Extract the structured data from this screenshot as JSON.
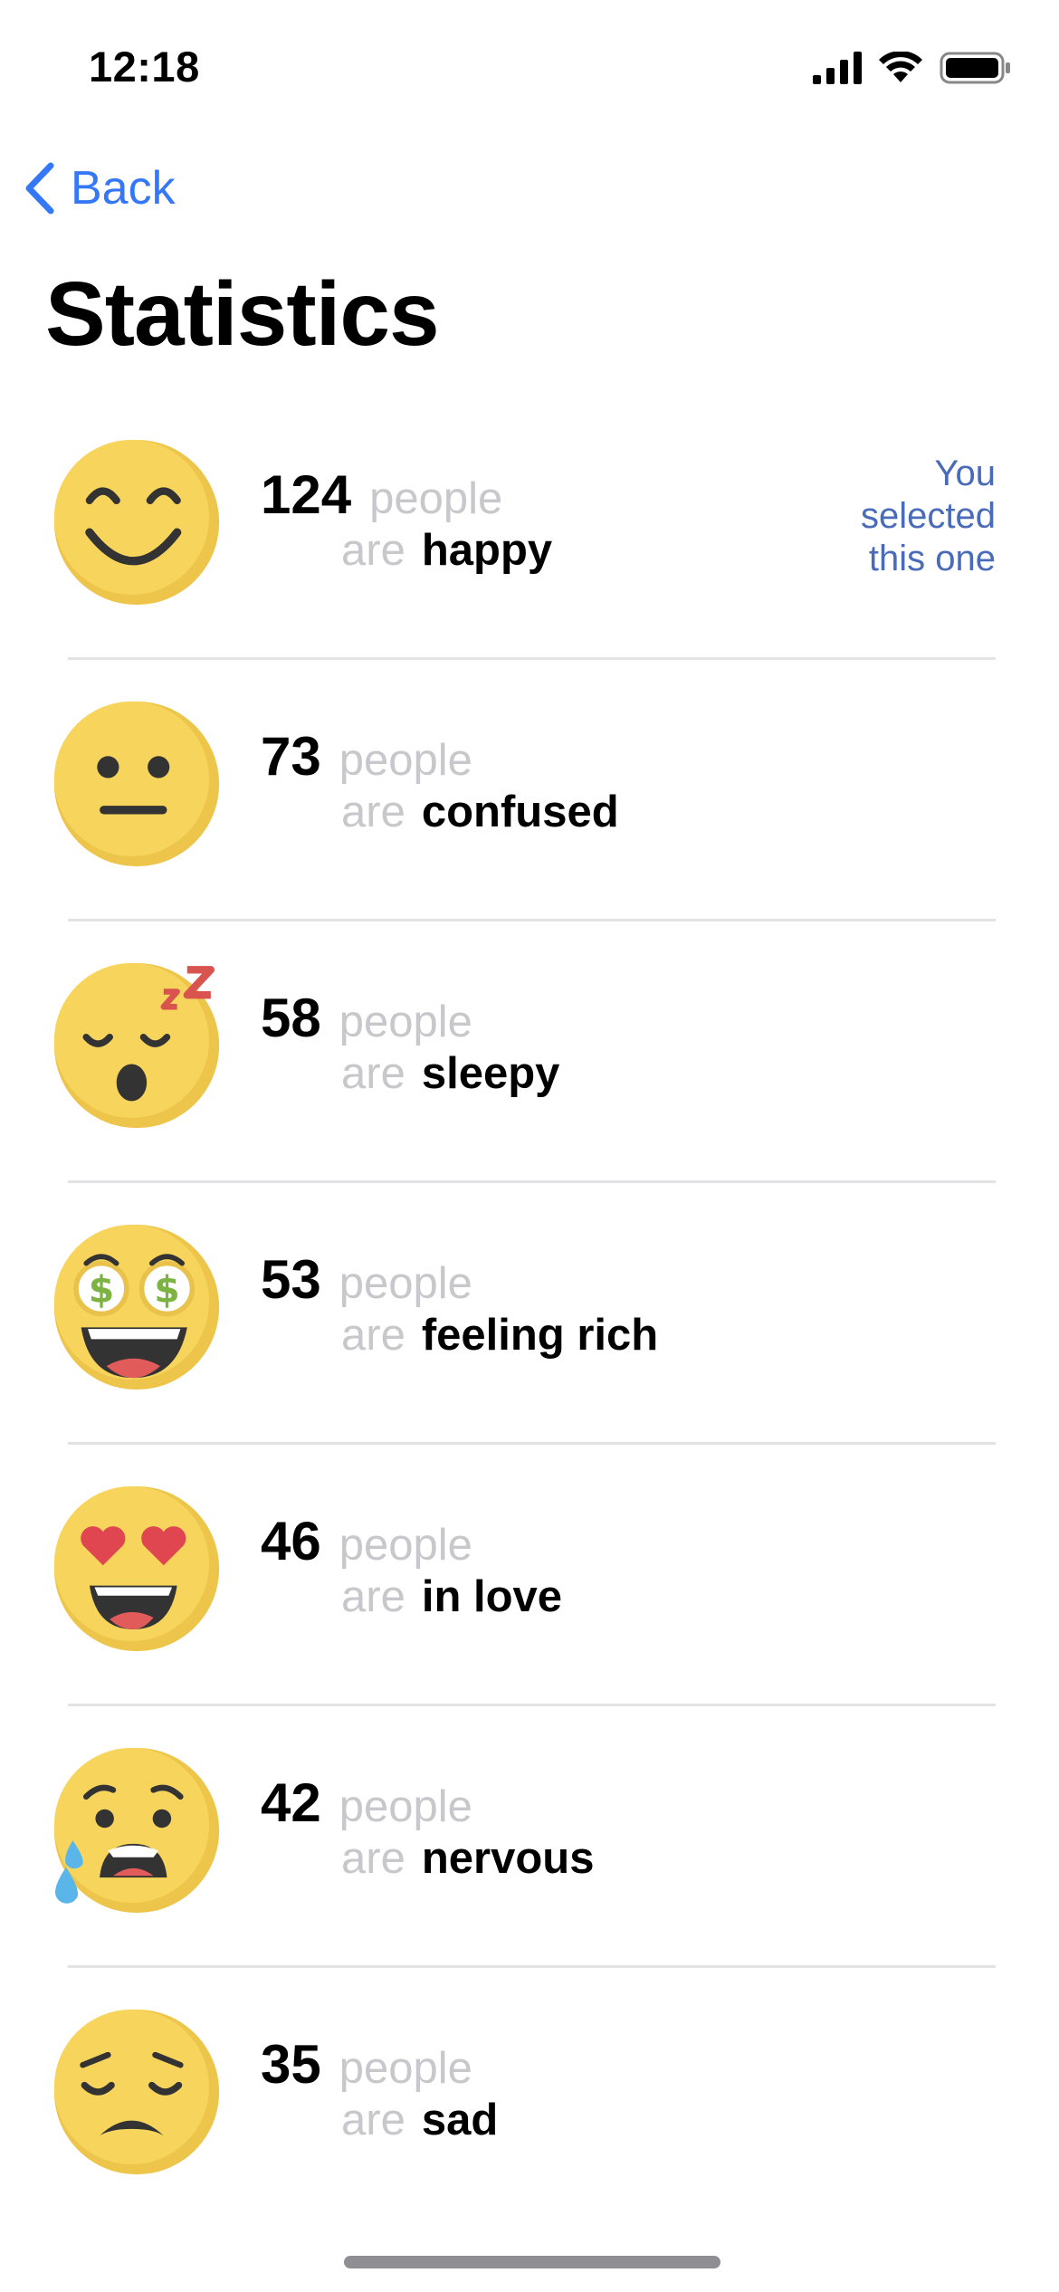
{
  "status": {
    "time": "12:18"
  },
  "nav": {
    "back_label": "Back",
    "title": "Statistics"
  },
  "labels": {
    "people": "people",
    "are": "are"
  },
  "selected_note": "You selected this one",
  "colors": {
    "accent": "#3478F6",
    "muted": "#c7c7cc",
    "note": "#4a6bb8",
    "emoji_face": "#F7D55C",
    "emoji_shade": "#EDC54B"
  },
  "stats": [
    {
      "count": "124",
      "mood": "happy",
      "icon": "smiling-face-icon",
      "selected": true
    },
    {
      "count": "73",
      "mood": "confused",
      "icon": "neutral-face-icon"
    },
    {
      "count": "58",
      "mood": "sleepy",
      "icon": "sleeping-face-icon"
    },
    {
      "count": "53",
      "mood": "feeling rich",
      "icon": "money-eyes-face-icon"
    },
    {
      "count": "46",
      "mood": "in love",
      "icon": "heart-eyes-face-icon"
    },
    {
      "count": "42",
      "mood": "nervous",
      "icon": "anxious-sweat-face-icon"
    },
    {
      "count": "35",
      "mood": "sad",
      "icon": "sad-face-icon"
    }
  ]
}
